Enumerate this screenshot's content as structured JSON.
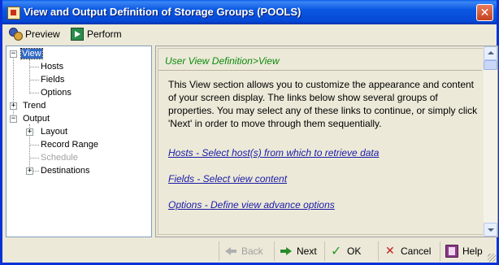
{
  "window": {
    "title": "View and Output Definition of Storage Groups (POOLS)",
    "close_symbol": "✕"
  },
  "toolbar": {
    "preview_label": "Preview",
    "perform_label": "Perform"
  },
  "tree": {
    "view": "View",
    "hosts": "Hosts",
    "fields": "Fields",
    "options": "Options",
    "trend": "Trend",
    "output": "Output",
    "layout": "Layout",
    "record_range": "Record Range",
    "schedule": "Schedule",
    "destinations": "Destinations",
    "expand_symbol": "+",
    "collapse_symbol": "−"
  },
  "content": {
    "breadcrumb": "User View Definition>View",
    "description_lines": [
      "This View section allows you to customize the appearance and content",
      "of your screen display. The links below show several groups of",
      "properties. You may select any of these links to continue, or simply click",
      "'Next' in order to move through them sequentially."
    ],
    "links": {
      "hosts": "Hosts - Select host(s) from which to retrieve data",
      "fields": "Fields - Select view content",
      "options": "Options - Define view advance options"
    }
  },
  "buttons": {
    "back": "Back",
    "next": "Next",
    "ok": "OK",
    "cancel": "Cancel",
    "help": "Help"
  },
  "colors": {
    "title_bar": "#0a58e2",
    "selection": "#316ac5",
    "breadcrumb": "#0a8a0a",
    "link": "#1a1aa8"
  }
}
